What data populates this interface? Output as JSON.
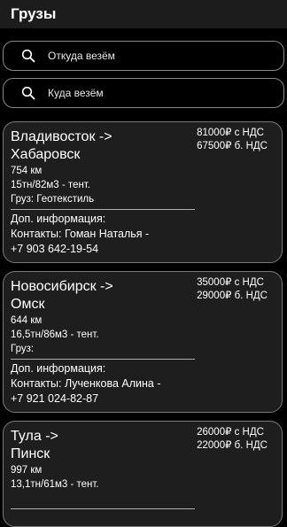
{
  "header": {
    "title": "Грузы"
  },
  "search": {
    "from_placeholder": "Откуда везём",
    "to_placeholder": "Куда везём"
  },
  "cargo": [
    {
      "route_from": "Владивосток ->",
      "route_to": "Хабаровск",
      "price_vat": "81000₽ с НДС",
      "price_no_vat": "67500₽ б. НДС",
      "distance": "754 км",
      "specs": "15тн/82м3 - тент.",
      "cargo": "Груз: Геотекстиль",
      "extra_label": "Доп. информация:",
      "contacts": "Контакты: Гоман Наталья -",
      "phone": "+7 903 642-19-54"
    },
    {
      "route_from": "Новосибирск ->",
      "route_to": "Омск",
      "price_vat": "35000₽ с НДС",
      "price_no_vat": "29000₽ б. НДС",
      "distance": "644 км",
      "specs": "16,5тн/86м3 - тент.",
      "cargo": "Груз:",
      "extra_label": "Доп. информация:",
      "contacts": "Контакты: Лученкова Алина -",
      "phone": "+7 921 024-82-87"
    },
    {
      "route_from": "Тула ->",
      "route_to": "Пинск",
      "price_vat": "26000₽ с НДС",
      "price_no_vat": "22000₽ б. НДС",
      "distance": "997 км",
      "specs": "13,1тн/61м3 - тент.",
      "cargo": "",
      "extra_label": "",
      "contacts": "",
      "phone": ""
    }
  ]
}
